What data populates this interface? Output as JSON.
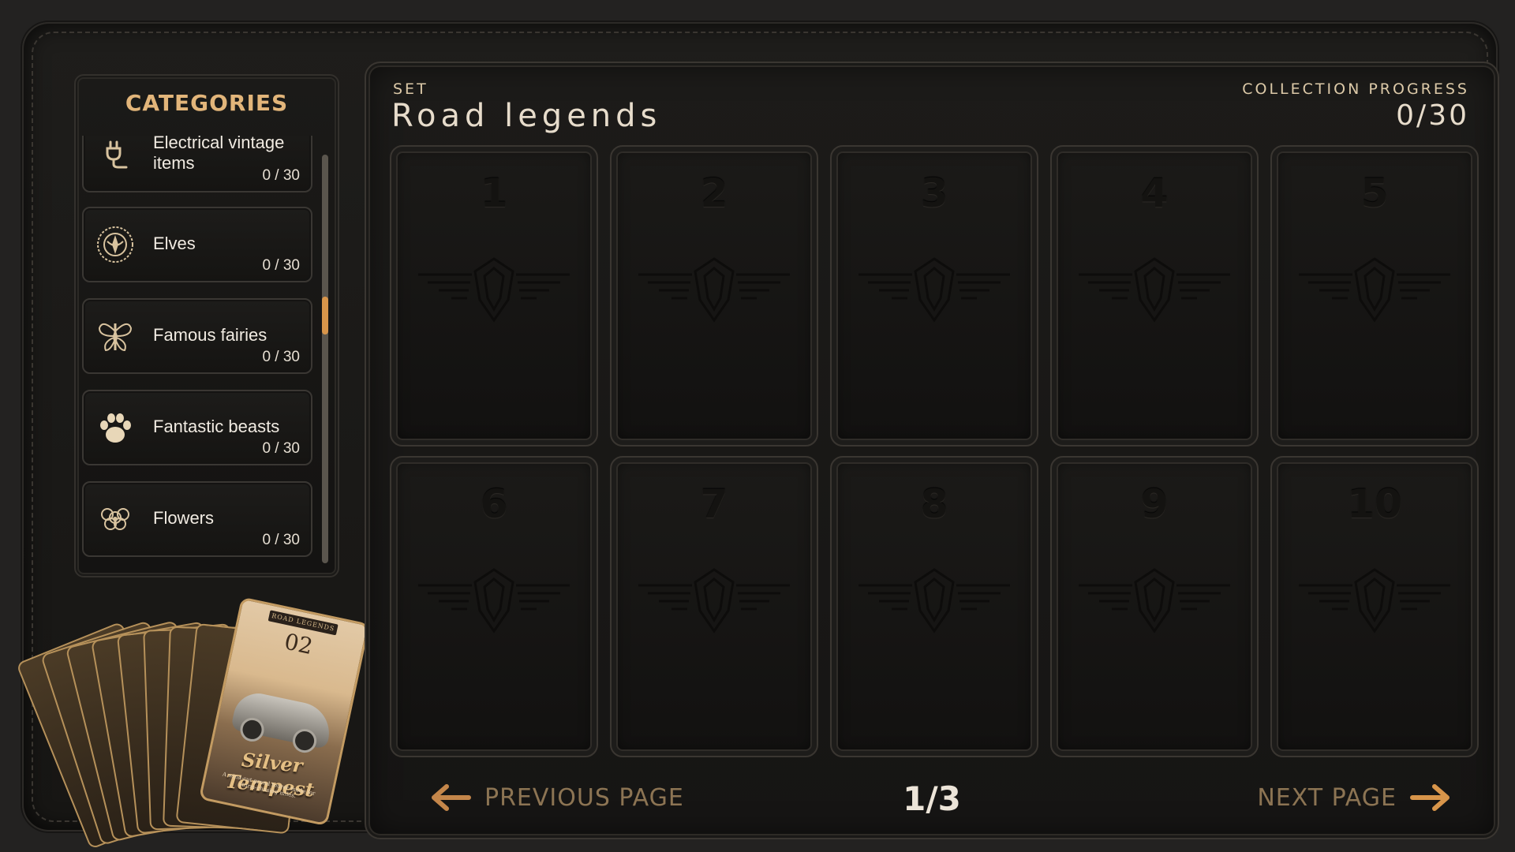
{
  "categories_panel": {
    "title": "CATEGORIES",
    "items": [
      {
        "label": "Electrical vintage items",
        "count": "0 / 30",
        "icon": "plug-icon"
      },
      {
        "label": "Elves",
        "count": "0 / 30",
        "icon": "elf-crest-icon"
      },
      {
        "label": "Famous fairies",
        "count": "0 / 30",
        "icon": "fairy-wings-icon"
      },
      {
        "label": "Fantastic beasts",
        "count": "0 / 30",
        "icon": "paw-icon"
      },
      {
        "label": "Flowers",
        "count": "0 / 30",
        "icon": "flower-icon"
      }
    ]
  },
  "featured_card": {
    "header": "ROAD LEGENDS",
    "number": "02",
    "name": "Silver Tempest",
    "tagline": "A wind-cut grand tourer made for storm-chasing miles."
  },
  "set": {
    "label": "SET",
    "name": "Road legends"
  },
  "progress": {
    "label": "COLLECTION PROGRESS",
    "value": "0/30",
    "collected": 0,
    "total": 30
  },
  "slots": [
    "1",
    "2",
    "3",
    "4",
    "5",
    "6",
    "7",
    "8",
    "9",
    "10"
  ],
  "pagination": {
    "prev_label": "PREVIOUS PAGE",
    "next_label": "NEXT PAGE",
    "page_indicator": "1/3"
  },
  "colors": {
    "accent": "#d8954a",
    "title_gold": "#e2b57a",
    "background": "#232221",
    "leather": "#1a1917"
  }
}
